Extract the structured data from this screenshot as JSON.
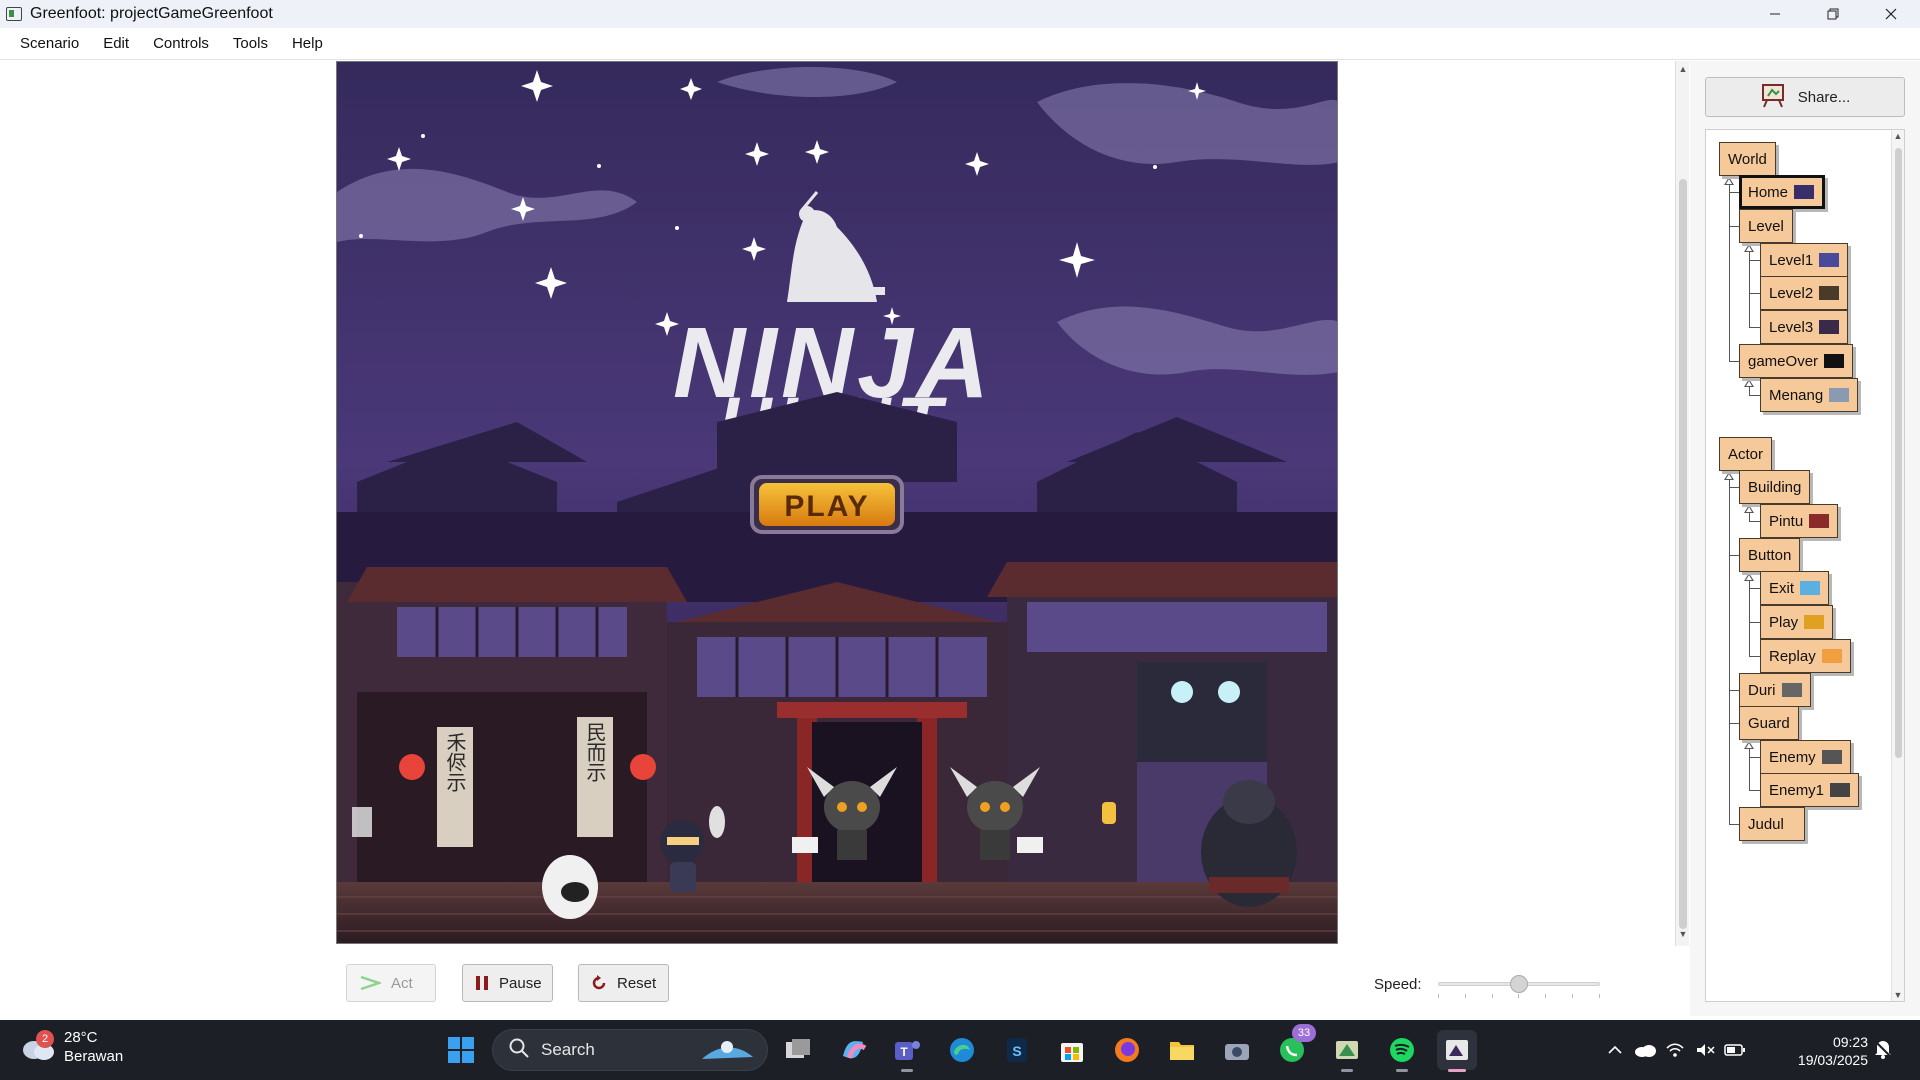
{
  "window": {
    "title": "Greenfoot: projectGameGreenfoot"
  },
  "menu": [
    "Scenario",
    "Edit",
    "Controls",
    "Tools",
    "Help"
  ],
  "game": {
    "title_line1": "NINJA",
    "title_line2": "HUNT",
    "play_label": "PLAY",
    "sign_left": "禾侭示",
    "sign_right": "民而示"
  },
  "controls": {
    "act_label": "Act",
    "pause_label": "Pause",
    "reset_label": "Reset",
    "speed_label": "Speed:",
    "speed_value": 0.5
  },
  "share_label": "Share...",
  "classes": {
    "world": [
      {
        "name": "World"
      },
      {
        "name": "Home",
        "selected": true
      },
      {
        "name": "Level"
      },
      {
        "name": "Level1"
      },
      {
        "name": "Level2"
      },
      {
        "name": "Level3"
      },
      {
        "name": "gameOver"
      },
      {
        "name": "Menang"
      }
    ],
    "actor": [
      {
        "name": "Actor"
      },
      {
        "name": "Building"
      },
      {
        "name": "Pintu"
      },
      {
        "name": "Button"
      },
      {
        "name": "Exit"
      },
      {
        "name": "Play"
      },
      {
        "name": "Replay"
      },
      {
        "name": "Duri"
      },
      {
        "name": "Guard"
      },
      {
        "name": "Enemy"
      },
      {
        "name": "Enemy1"
      },
      {
        "name": "Judul"
      }
    ]
  },
  "taskbar": {
    "weather_badge": "2",
    "temperature": "28°C",
    "condition": "Berawan",
    "search_placeholder": "Search",
    "whatsapp_badge": "33",
    "time": "09:23",
    "date": "19/03/2025"
  }
}
